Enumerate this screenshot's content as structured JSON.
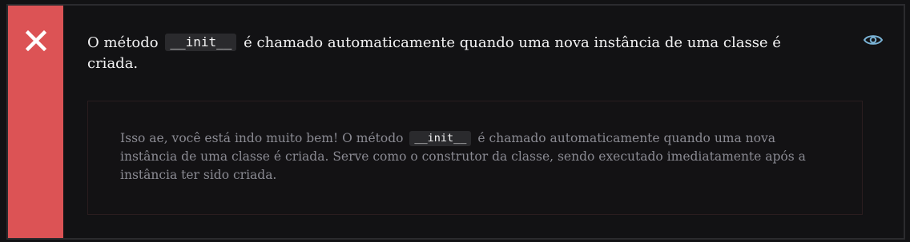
{
  "feedback": {
    "status": "incorrect",
    "status_icon": "close-icon",
    "status_color": "#dc5355",
    "question_before": "O método",
    "question_code": "__init__",
    "question_after": "é chamado automaticamente quando uma nova instância de uma classe é criada.",
    "toggle_icon": "eye-icon",
    "accent_color": "#7ab3d6",
    "explanation_before": "Isso ae, você está indo muito bem! O método",
    "explanation_code": "__init__",
    "explanation_after": "é chamado automaticamente quando uma nova instância de uma classe é criada. Serve como o construtor da classe, sendo executado imediatamente após a instância ter sido criada."
  }
}
